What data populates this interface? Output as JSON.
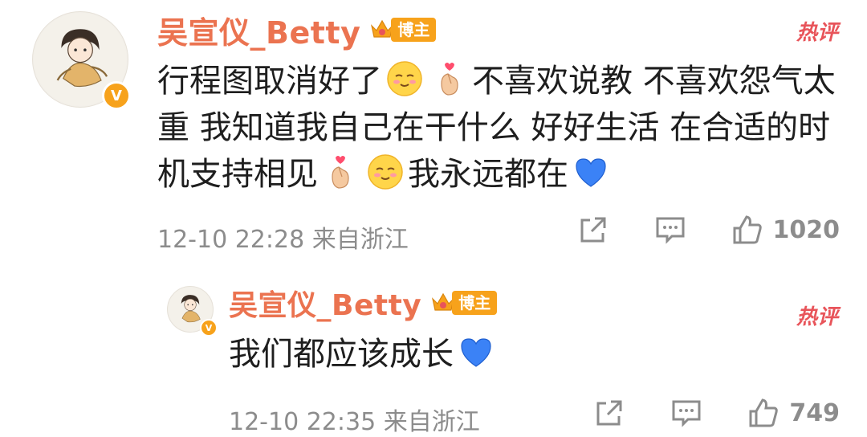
{
  "colors": {
    "username": "#eb7350",
    "badge": "#f7a21b",
    "hot": "#e8545a",
    "meta": "#8c8c8c",
    "heart": "#3b82f6"
  },
  "comments": [
    {
      "username": "吴宣仪_Betty",
      "badge_label": "博主",
      "hot_label": "热评",
      "verified_label": "V",
      "text_segments": [
        "行程图取消好了",
        "不喜欢说教 不喜欢怨气太重 我知道我自己在干什么 好好生活 在合适的时机支持相见",
        "我永远都在"
      ],
      "timestamp": "12-10 22:28",
      "location": "来自浙江",
      "like_count": "1020",
      "icons": [
        "share-icon",
        "comment-icon",
        "like-icon"
      ]
    },
    {
      "username": "吴宣仪_Betty",
      "badge_label": "博主",
      "hot_label": "热评",
      "verified_label": "V",
      "text_segments": [
        "我们都应该成长"
      ],
      "timestamp": "12-10 22:35",
      "location": "来自浙江",
      "like_count": "749",
      "icons": [
        "share-icon",
        "comment-icon",
        "like-icon"
      ]
    }
  ]
}
